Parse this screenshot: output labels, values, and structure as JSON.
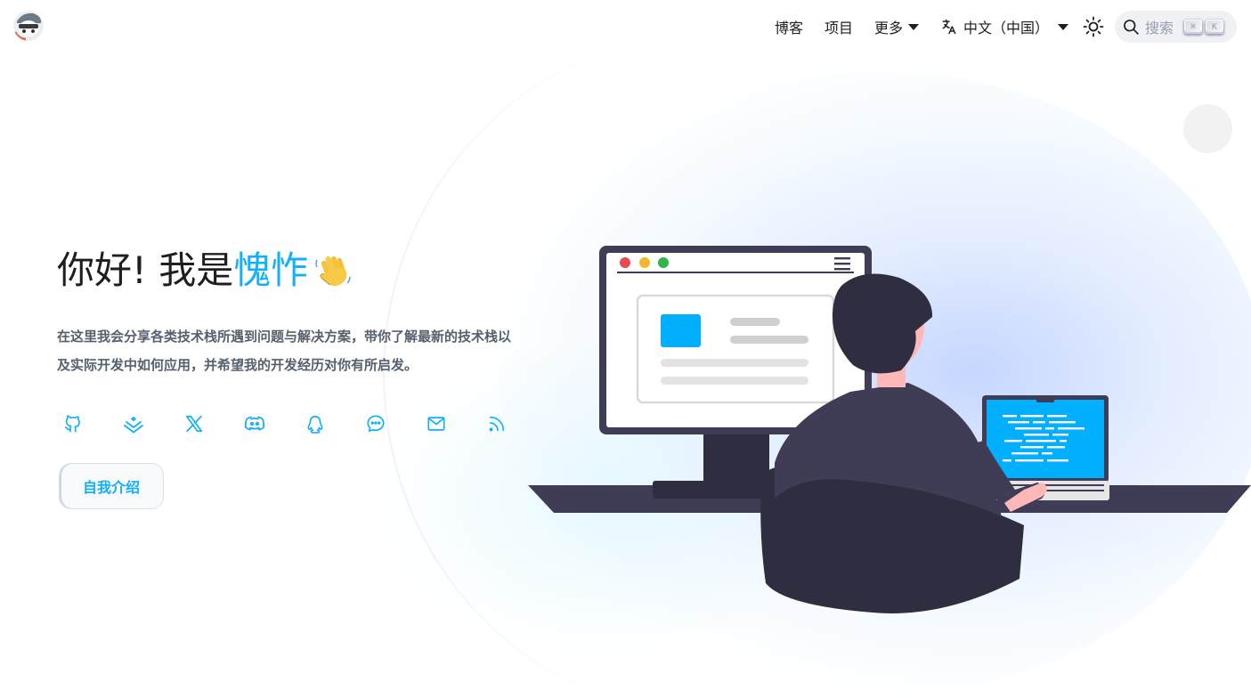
{
  "navbar": {
    "logo_alt": "avatar",
    "links": {
      "blog": "博客",
      "projects": "项目",
      "more": "更多"
    },
    "language": "中文（中国）",
    "search": {
      "label": "搜索",
      "key1": "⌘",
      "key2": "K"
    }
  },
  "hero": {
    "title_prefix": "你好! 我是",
    "name": "愧怍",
    "description": "在这里我会分享各类技术栈所遇到问题与解决方案，带你了解最新的技术栈以及实际开发中如何应用，并希望我的开发经历对你有所启发。",
    "socials": [
      "github-icon",
      "juejin-icon",
      "x-icon",
      "discord-icon",
      "qq-icon",
      "wechat-icon",
      "email-icon",
      "rss-icon"
    ],
    "about_button": "自我介绍"
  },
  "colors": {
    "accent": "#12affa",
    "text": "#1c1e21",
    "muted": "#56606e",
    "dark": "#2f2e41",
    "screen_blue": "#00b0ff"
  }
}
